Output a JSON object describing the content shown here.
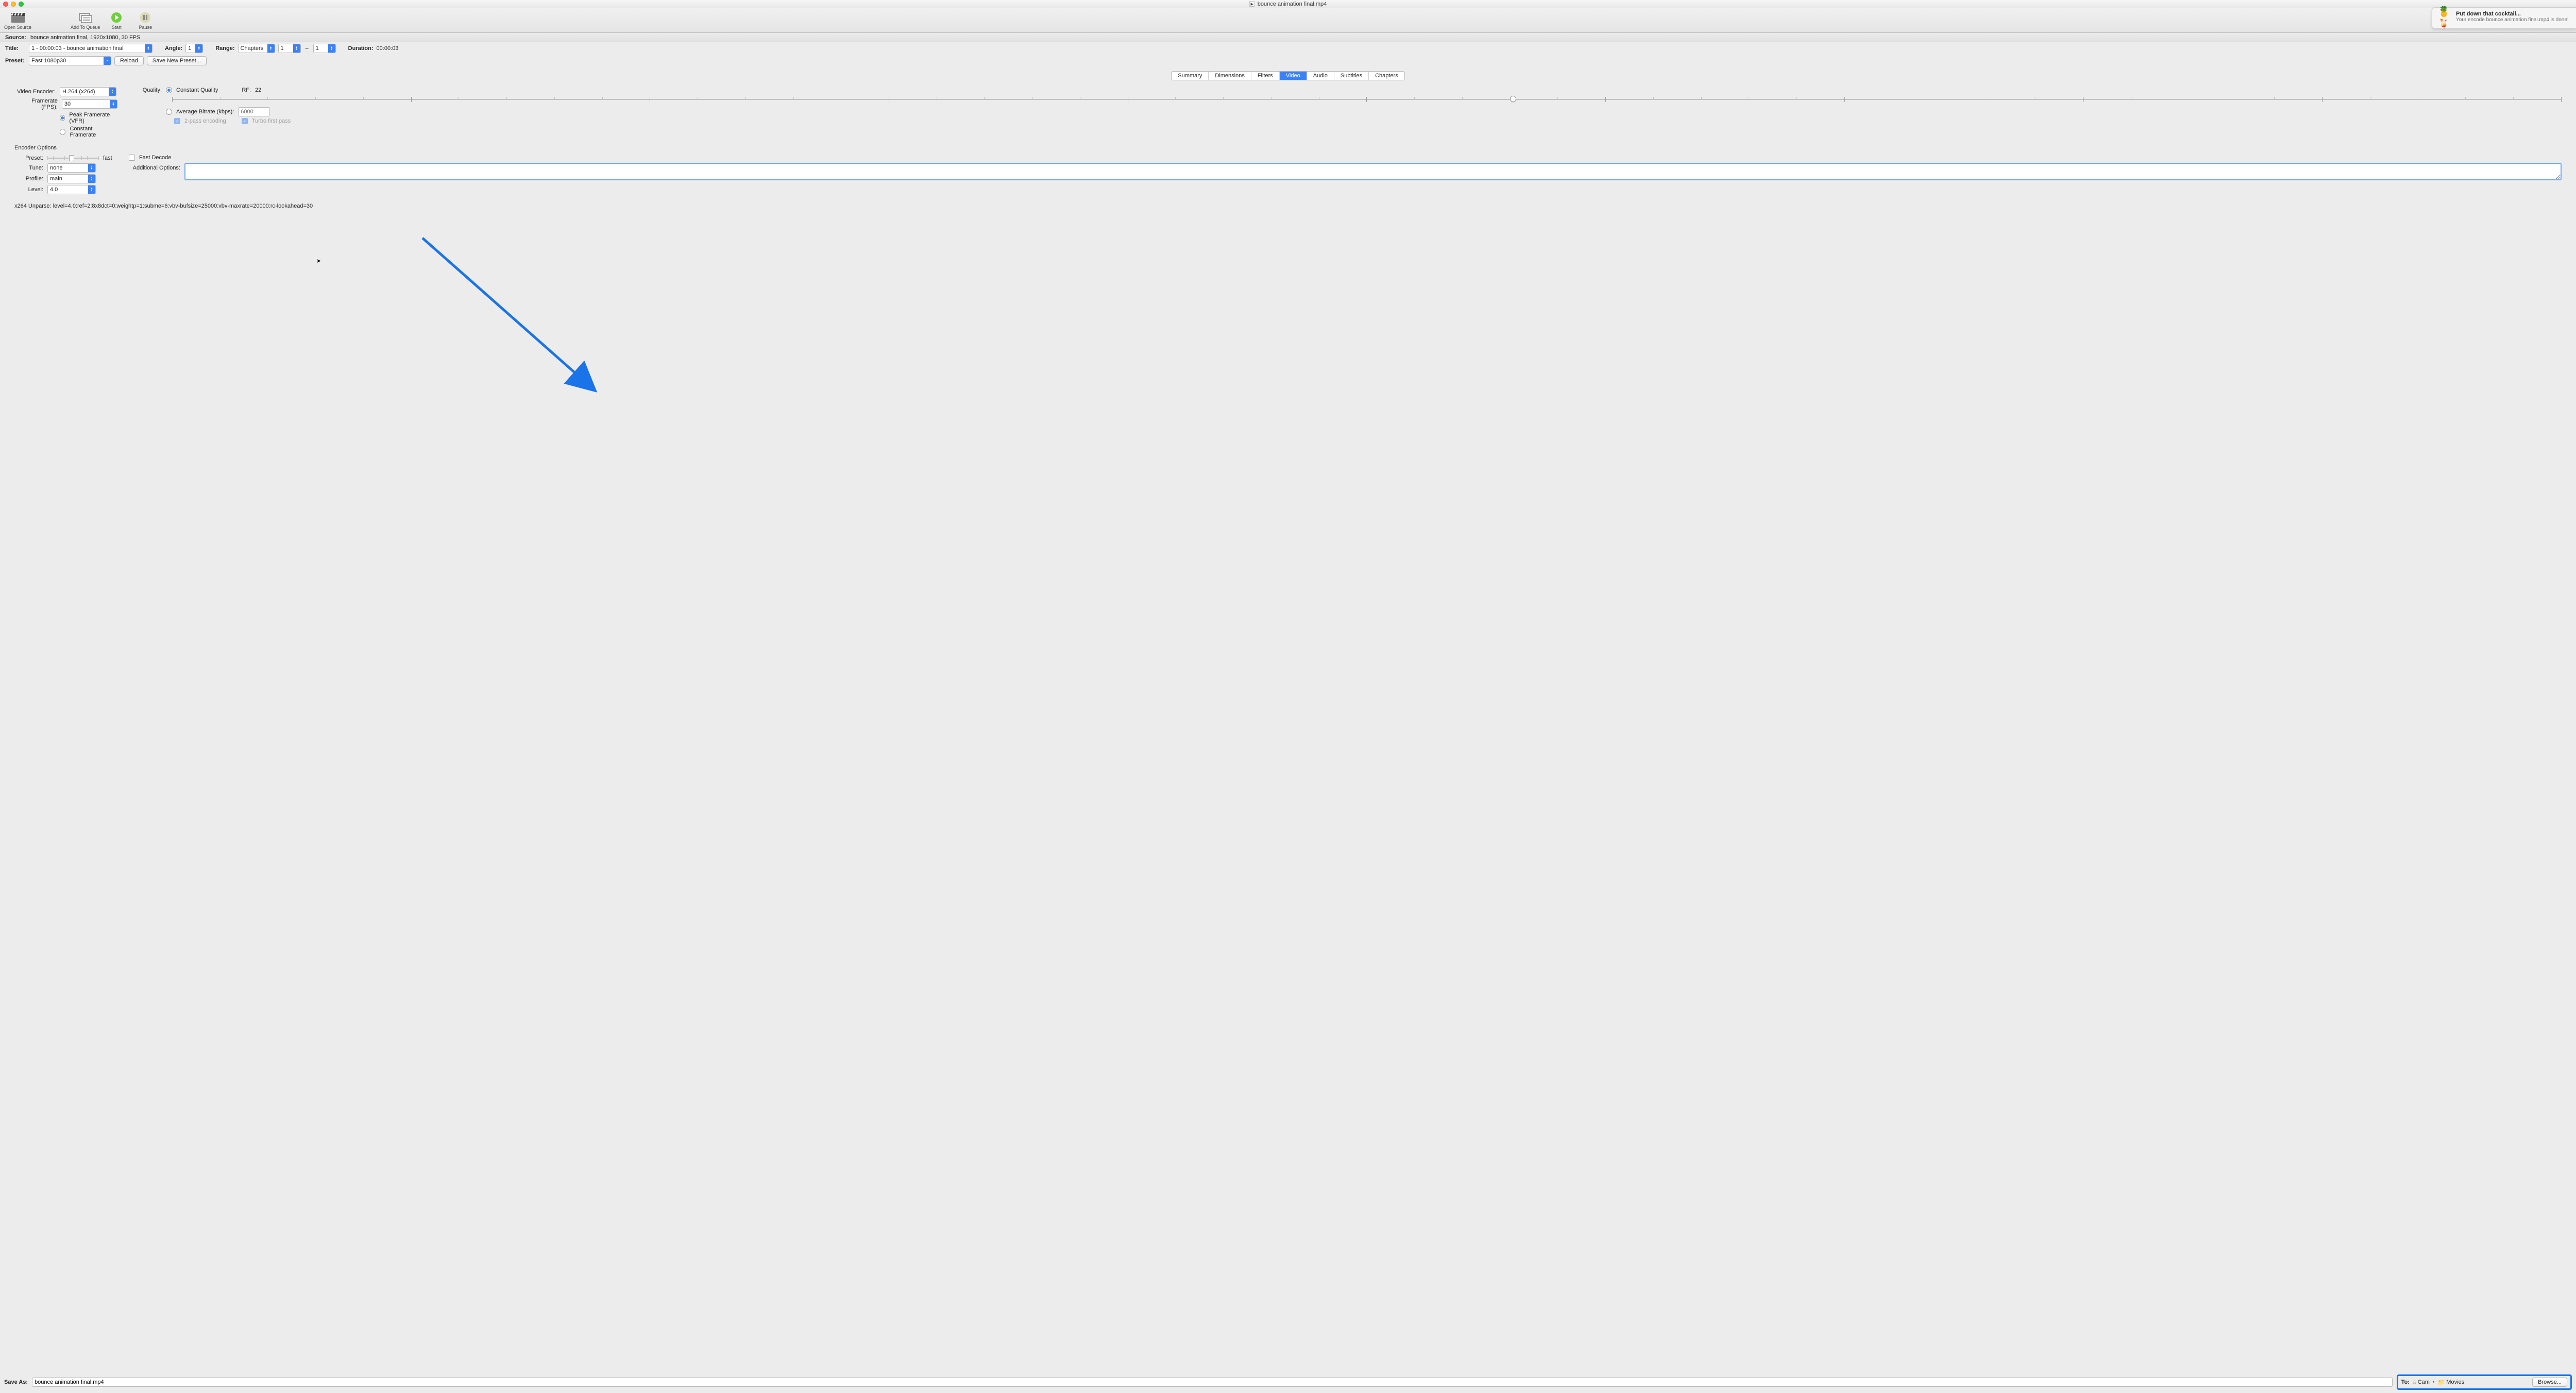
{
  "window": {
    "title": "bounce animation final.mp4"
  },
  "toolbar": {
    "open_source": "Open Source",
    "add_to_queue": "Add To Queue",
    "start": "Start",
    "pause": "Pause"
  },
  "source": {
    "label": "Source:",
    "value": "bounce animation final, 1920x1080, 30 FPS"
  },
  "title_row": {
    "label": "Title:",
    "selected": "1 - 00:00:03 - bounce animation final",
    "angle_label": "Angle:",
    "angle_value": "1",
    "range_label": "Range:",
    "range_mode": "Chapters",
    "range_from": "1",
    "range_to": "1",
    "duration_label": "Duration:",
    "duration_value": "00:00:03"
  },
  "preset_row": {
    "label": "Preset:",
    "value": "Fast 1080p30",
    "reload": "Reload",
    "save_new": "Save New Preset..."
  },
  "tabs": {
    "items": [
      "Summary",
      "Dimensions",
      "Filters",
      "Video",
      "Audio",
      "Subtitles",
      "Chapters"
    ],
    "active_index": 3
  },
  "video_tab": {
    "encoder_label": "Video Encoder:",
    "encoder_value": "H.264 (x264)",
    "fps_label": "Framerate (FPS):",
    "fps_value": "30",
    "peak_vfr": "Peak Framerate (VFR)",
    "constant_fr": "Constant Framerate",
    "quality_label": "Quality:",
    "constant_quality": "Constant Quality",
    "rf_label": "RF:",
    "rf_value": "22",
    "avg_bitrate": "Average Bitrate (kbps):",
    "avg_bitrate_placeholder": "6000",
    "twopass": "2-pass encoding",
    "turbo": "Turbo first pass"
  },
  "encoder_options": {
    "header": "Encoder Options",
    "preset_label": "Preset:",
    "preset_value_label": "fast",
    "tune_label": "Tune:",
    "tune_value": "none",
    "fast_decode": "Fast Decode",
    "profile_label": "Profile:",
    "profile_value": "main",
    "level_label": "Level:",
    "level_value": "4.0",
    "additional_label": "Additional Options:",
    "additional_value": ""
  },
  "unparse": "x264 Unparse: level=4.0:ref=2:8x8dct=0:weightp=1:subme=6:vbv-bufsize=25000:vbv-maxrate=20000:rc-lookahead=30",
  "bottom": {
    "saveas_label": "Save As:",
    "saveas_value": "bounce animation final.mp4",
    "to_label": "To:",
    "crumb1": "Cam",
    "crumb2": "Movies",
    "browse": "Browse..."
  },
  "notification": {
    "title": "Put down that cocktail...",
    "subtitle": "Your encode bounce animation final.mp4 is done!"
  }
}
